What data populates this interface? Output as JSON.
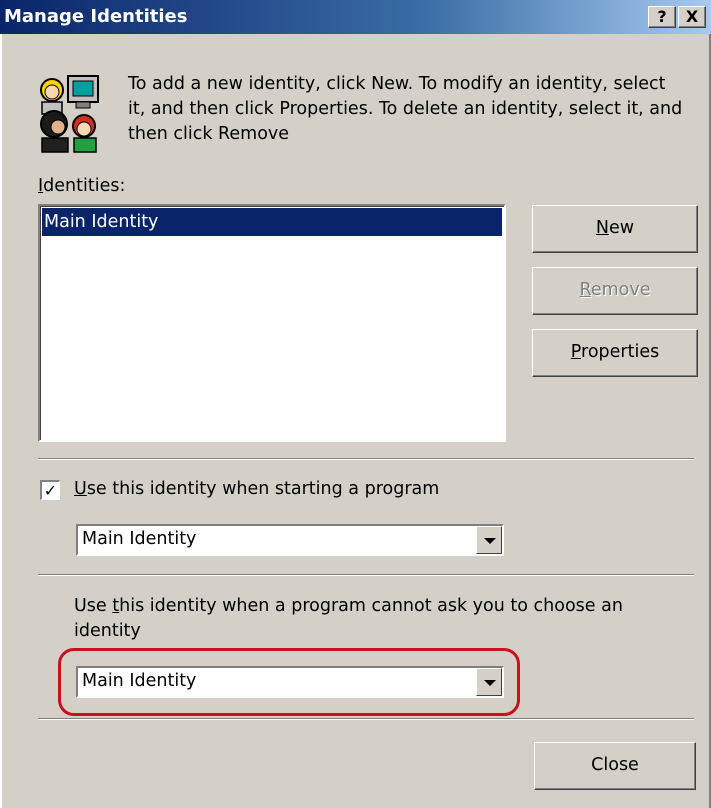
{
  "window": {
    "title": "Manage Identities",
    "help_button": "?",
    "close_button": "X"
  },
  "intro": {
    "text": "To add a new identity, click New.  To modify an identity, select it, and then click Properties.  To delete an identity, select it, and then click Remove",
    "icon": "identities-people-icon"
  },
  "identities": {
    "label_mnemonic": "I",
    "label_rest": "dentities:",
    "items": [
      "Main Identity"
    ],
    "selected_index": 0
  },
  "buttons": {
    "new": {
      "mnemonic": "N",
      "rest": "ew",
      "enabled": true
    },
    "remove": {
      "mnemonic": "R",
      "rest": "emove",
      "enabled": false
    },
    "properties": {
      "mnemonic": "P",
      "rest": "roperties",
      "enabled": true
    }
  },
  "startup": {
    "checked": true,
    "check_glyph": "✓",
    "label_mnemonic": "U",
    "label_rest": "se this identity when starting a program",
    "selected": "Main Identity"
  },
  "default": {
    "label_pre": "Use ",
    "label_mnemonic": "t",
    "label_rest": "his identity when a program cannot ask you to choose an identity",
    "selected": "Main Identity"
  },
  "close_label": "Close",
  "colors": {
    "face": "#d4d0c8",
    "selection": "#0a246a",
    "highlight_ring": "#c8101e",
    "title_start": "#0a246a",
    "title_end": "#a6caf0"
  }
}
